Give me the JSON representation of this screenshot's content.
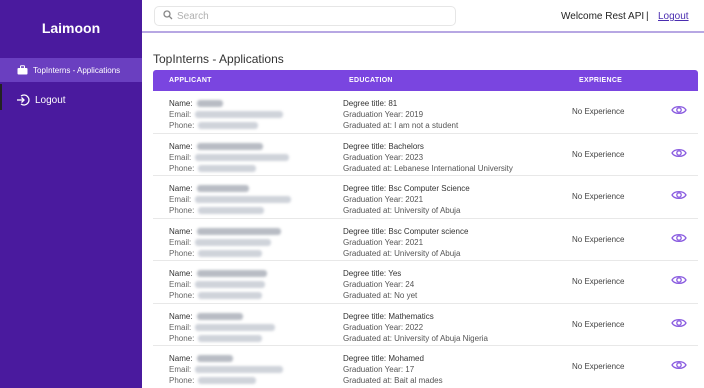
{
  "app": {
    "name": "Laimoon"
  },
  "sidebar": {
    "items": [
      {
        "label": "TopInterns - Applications",
        "icon": "briefcase-icon"
      },
      {
        "label": "Logout",
        "icon": "logout-icon"
      }
    ]
  },
  "topbar": {
    "search_placeholder": "Search",
    "welcome": "Welcome Rest API",
    "separator": "|",
    "logout_label": "Logout"
  },
  "page": {
    "title": "TopInterns - Applications"
  },
  "table": {
    "headers": {
      "applicant": "APPLICANT",
      "education": "EDUCATION",
      "experience": "EXPRIENCE"
    },
    "rows": [
      {
        "name_label": "Name:",
        "email_label": "Email:",
        "phone_label": "Phone:",
        "degree": "Degree title: 81",
        "grad_year": "Graduation Year: 2019",
        "grad_at": "Graduated at: I am not a student",
        "experience": "No Experience"
      },
      {
        "name_label": "Name:",
        "email_label": "Email:",
        "phone_label": "Phone:",
        "degree": "Degree title: Bachelors",
        "grad_year": "Graduation Year: 2023",
        "grad_at": "Graduated at: Lebanese International University",
        "experience": "No Experience"
      },
      {
        "name_label": "Name:",
        "email_label": "Email:",
        "phone_label": "Phone:",
        "degree": "Degree title: Bsc Computer Science",
        "grad_year": "Graduation Year: 2021",
        "grad_at": "Graduated at: University of Abuja",
        "experience": "No Experience"
      },
      {
        "name_label": "Name:",
        "email_label": "Email:",
        "phone_label": "Phone:",
        "degree": "Degree title: Bsc Computer science",
        "grad_year": "Graduation Year: 2021",
        "grad_at": "Graduated at: University of Abuja",
        "experience": "No Experience"
      },
      {
        "name_label": "Name:",
        "email_label": "Email:",
        "phone_label": "Phone:",
        "degree": "Degree title: Yes",
        "grad_year": "Graduation Year: 24",
        "grad_at": "Graduated at: No yet",
        "experience": "No Experience"
      },
      {
        "name_label": "Name:",
        "email_label": "Email:",
        "phone_label": "Phone:",
        "degree": "Degree title: Mathematics",
        "grad_year": "Graduation Year: 2022",
        "grad_at": "Graduated at: University of Abuja Nigeria",
        "experience": "No Experience"
      },
      {
        "name_label": "Name:",
        "email_label": "Email:",
        "phone_label": "Phone:",
        "degree": "Degree title: Mohamed",
        "grad_year": "Graduation Year: 17",
        "grad_at": "Graduated at: Bait al mades",
        "experience": "No Experience"
      }
    ]
  },
  "colors": {
    "sidebar": "#4a1a9e",
    "sidebar_active": "#6a3fc0",
    "table_header": "#7a45e0",
    "accent": "#7a45e0"
  }
}
